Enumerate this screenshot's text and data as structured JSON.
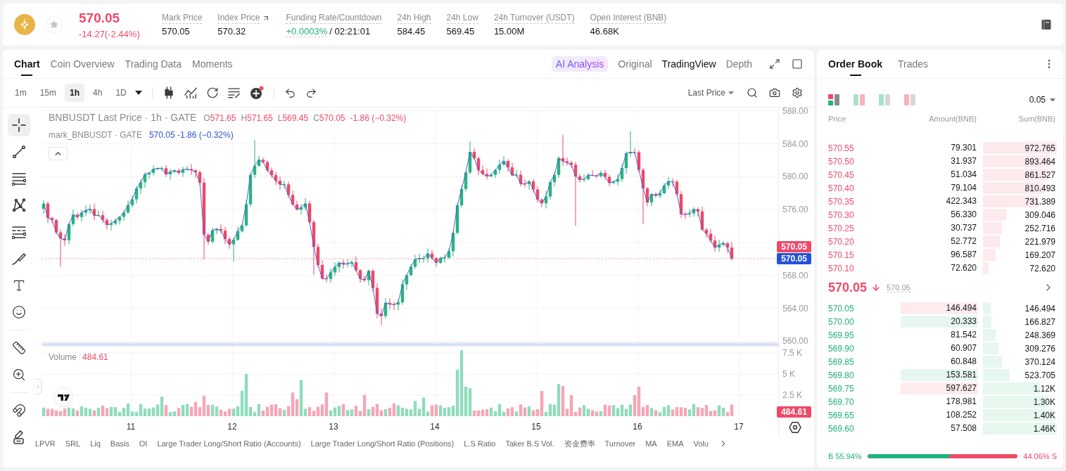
{
  "ticker": {
    "price": "570.05",
    "falling": true,
    "change": "-14.27(-2.44%)",
    "favorite": false,
    "stats": [
      {
        "kind": "plain",
        "label": "Mark Price",
        "value": "570.05"
      },
      {
        "kind": "link",
        "label": "Index Price",
        "value": "570.32"
      },
      {
        "kind": "funding",
        "label": "Funding Rate/Countdown",
        "rate": "+0.0003%",
        "positive": true,
        "countdown": "/ 02:21:01"
      },
      {
        "kind": "plain",
        "label": "24h High",
        "value": "584.45"
      },
      {
        "kind": "plain",
        "label": "24h Low",
        "value": "569.45"
      },
      {
        "kind": "plain",
        "label": "24h Turnover (USDT)",
        "value": "15.00M"
      },
      {
        "kind": "plain",
        "label": "Open Interest (BNB)",
        "value": "46.68K"
      }
    ]
  },
  "chart_panel": {
    "tabs": [
      {
        "label": "Chart",
        "selected": true
      },
      {
        "label": "Coin Overview",
        "selected": false
      },
      {
        "label": "Trading Data",
        "selected": false
      },
      {
        "label": "Moments",
        "selected": false
      }
    ],
    "ai_button": "AI Analysis",
    "views": [
      {
        "label": "Original",
        "selected": false
      },
      {
        "label": "TradingView",
        "selected": true
      },
      {
        "label": "Depth",
        "selected": false
      }
    ],
    "intervals": [
      {
        "label": "1m",
        "selected": false
      },
      {
        "label": "15m",
        "selected": false
      },
      {
        "label": "1h",
        "selected": true
      },
      {
        "label": "4h",
        "selected": false
      },
      {
        "label": "1D",
        "selected": false
      }
    ],
    "price_source": "Last Price",
    "drawing_tools": [
      {
        "selected": true
      },
      {
        "selected": false
      },
      {
        "selected": false
      },
      {
        "selected": false
      },
      {
        "selected": false
      },
      {
        "selected": false
      },
      {
        "selected": false
      },
      {
        "selected": false
      },
      {
        "selected": false
      },
      {
        "selected": false
      },
      {
        "selected": false
      },
      {
        "selected": false
      }
    ],
    "legend": {
      "title": "BNBUSDT Last Price · 1h · GATE",
      "falling": true,
      "ohlc": [
        {
          "key": "O",
          "value": "571.65"
        },
        {
          "key": "H",
          "value": "571.65"
        },
        {
          "key": "L",
          "value": "569.45"
        },
        {
          "key": "C",
          "value": "570.05"
        }
      ],
      "change": "-1.86 (−0.32%)",
      "mark_title": "mark_BNBUSDT · GATE",
      "mark_value": "570.05 -1.86 (−0.32%)"
    },
    "price_axis": {
      "upper_ticks": [
        "588.00",
        "584.00",
        "580.00",
        "576.00"
      ],
      "last_price_tag": "570.05",
      "mark_price_tag": "570.05",
      "lower_ticks": [
        "568.00",
        "564.00",
        "560.00"
      ]
    },
    "volume": {
      "label": "Volume",
      "value": "484.61",
      "ticks": [
        "7.5 K",
        "5 K",
        "2.5 K"
      ],
      "tag": "484.61"
    },
    "time_axis": [
      "11",
      "12",
      "13",
      "14",
      "15",
      "16",
      "17"
    ],
    "indicators": [
      "LPVR",
      "SRL",
      "Liq",
      "Basis",
      "OI",
      "Large Trader Long/Short Ratio (Accounts)",
      "Large Trader Long/Short Ratio (Positions)",
      "L.S Ratio",
      "Taker B.S Vol.",
      "资金费率",
      "Turnover",
      "MA",
      "EMA",
      "Volu"
    ]
  },
  "order_book": {
    "tabs": [
      {
        "label": "Order Book",
        "selected": true
      },
      {
        "label": "Trades",
        "selected": false
      }
    ],
    "layouts": [
      {
        "selected": true
      },
      {
        "selected": false
      },
      {
        "selected": false
      },
      {
        "selected": false
      }
    ],
    "tick_size": "0.05",
    "columns": [
      "Price",
      "Amount(BNB)",
      "Sum(BNB)"
    ],
    "asks": [
      {
        "price": "570.55",
        "amount": "79.301",
        "sum": "972.765",
        "level": 1.0
      },
      {
        "price": "570.50",
        "amount": "31.937",
        "sum": "893.464",
        "level": 0.918
      },
      {
        "price": "570.45",
        "amount": "51.034",
        "sum": "861.527",
        "level": 0.886
      },
      {
        "price": "570.40",
        "amount": "79.104",
        "sum": "810.493",
        "level": 0.833
      },
      {
        "price": "570.35",
        "amount": "422.343",
        "sum": "731.389",
        "level": 0.752
      },
      {
        "price": "570.30",
        "amount": "56.330",
        "sum": "309.046",
        "level": 0.318
      },
      {
        "price": "570.25",
        "amount": "30.737",
        "sum": "252.716",
        "level": 0.26
      },
      {
        "price": "570.20",
        "amount": "52.772",
        "sum": "221.979",
        "level": 0.228
      },
      {
        "price": "570.15",
        "amount": "96.587",
        "sum": "169.207",
        "level": 0.174
      },
      {
        "price": "570.10",
        "amount": "72.620",
        "sum": "72.620",
        "level": 0.075
      }
    ],
    "last": {
      "price": "570.05",
      "falling": true,
      "mark": "570.05"
    },
    "bids": [
      {
        "price": "570.05",
        "amount": "146.494",
        "sum": "146.494",
        "level": 0.1,
        "color": "#fdebee"
      },
      {
        "price": "570.00",
        "amount": "20.333",
        "sum": "166.827",
        "level": 0.114,
        "color": "#e6f7ef"
      },
      {
        "price": "569.95",
        "amount": "81.542",
        "sum": "248.369",
        "level": 0.17
      },
      {
        "price": "569.90",
        "amount": "60.907",
        "sum": "309.276",
        "level": 0.212
      },
      {
        "price": "569.85",
        "amount": "60.848",
        "sum": "370.124",
        "level": 0.254
      },
      {
        "price": "569.80",
        "amount": "153.581",
        "sum": "523.705",
        "level": 0.359,
        "color": "#e6f7ef"
      },
      {
        "price": "569.75",
        "amount": "597.627",
        "sum": "1.12K",
        "level": 0.767,
        "color": "#fdebee"
      },
      {
        "price": "569.70",
        "amount": "178.981",
        "sum": "1.30K",
        "level": 0.89
      },
      {
        "price": "569.65",
        "amount": "108.252",
        "sum": "1.40K",
        "level": 0.959
      },
      {
        "price": "569.60",
        "amount": "57.508",
        "sum": "1.46K",
        "level": 1.0
      }
    ],
    "ratio": {
      "buy": "B 55.94%",
      "sell": "44.06% S",
      "level": 0.5594
    }
  }
}
